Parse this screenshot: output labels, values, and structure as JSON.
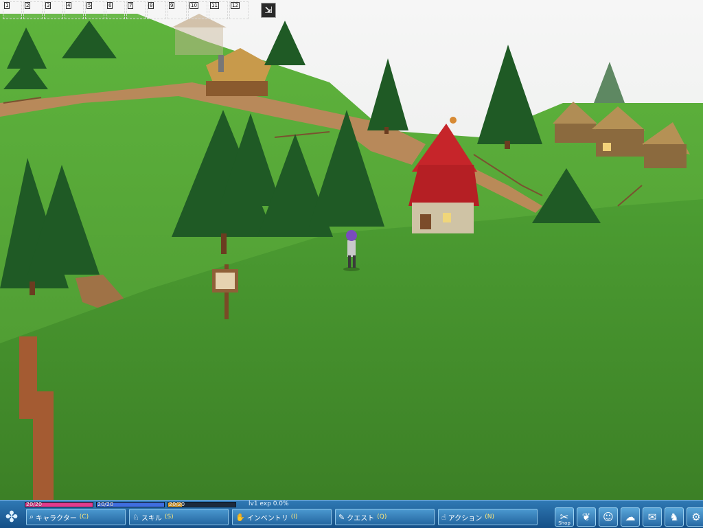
{
  "hotbar": {
    "slots": [
      "1",
      "2",
      "3",
      "4",
      "5",
      "6",
      "7",
      "8",
      "9",
      "10",
      "11",
      "12"
    ]
  },
  "status": {
    "hp": {
      "text": "20/20",
      "fill": 1.0,
      "color": "#e23b8d"
    },
    "mp": {
      "text": "20/20",
      "fill": 1.0,
      "color": "#3f6ee0"
    },
    "sp": {
      "text": "20/20",
      "fill": 0.2,
      "color": "#e8a62c"
    },
    "level": "lv1 exp 0.0%"
  },
  "menu": {
    "logo_icon": "clover-icon",
    "buttons": [
      {
        "label": "キャラクター",
        "hotkey": "(C)",
        "icon": "magnifier-icon"
      },
      {
        "label": "スキル",
        "hotkey": "(S)",
        "icon": "skill-icon"
      },
      {
        "label": "インベントリ",
        "hotkey": "(I)",
        "icon": "bag-icon"
      },
      {
        "label": "クエスト",
        "hotkey": "(Q)",
        "icon": "quest-icon"
      },
      {
        "label": "アクション",
        "hotkey": "(N)",
        "icon": "action-icon"
      }
    ]
  },
  "system": {
    "shop_label": "Shop",
    "icons": [
      "shop-icon",
      "wings-icon",
      "friends-icon",
      "chat-icon",
      "mail-icon",
      "pet-icon",
      "settings-icon"
    ]
  },
  "colors": {
    "hud": "#1d5d96",
    "grass": "#5aa83a",
    "roof_red": "#c6252a"
  }
}
